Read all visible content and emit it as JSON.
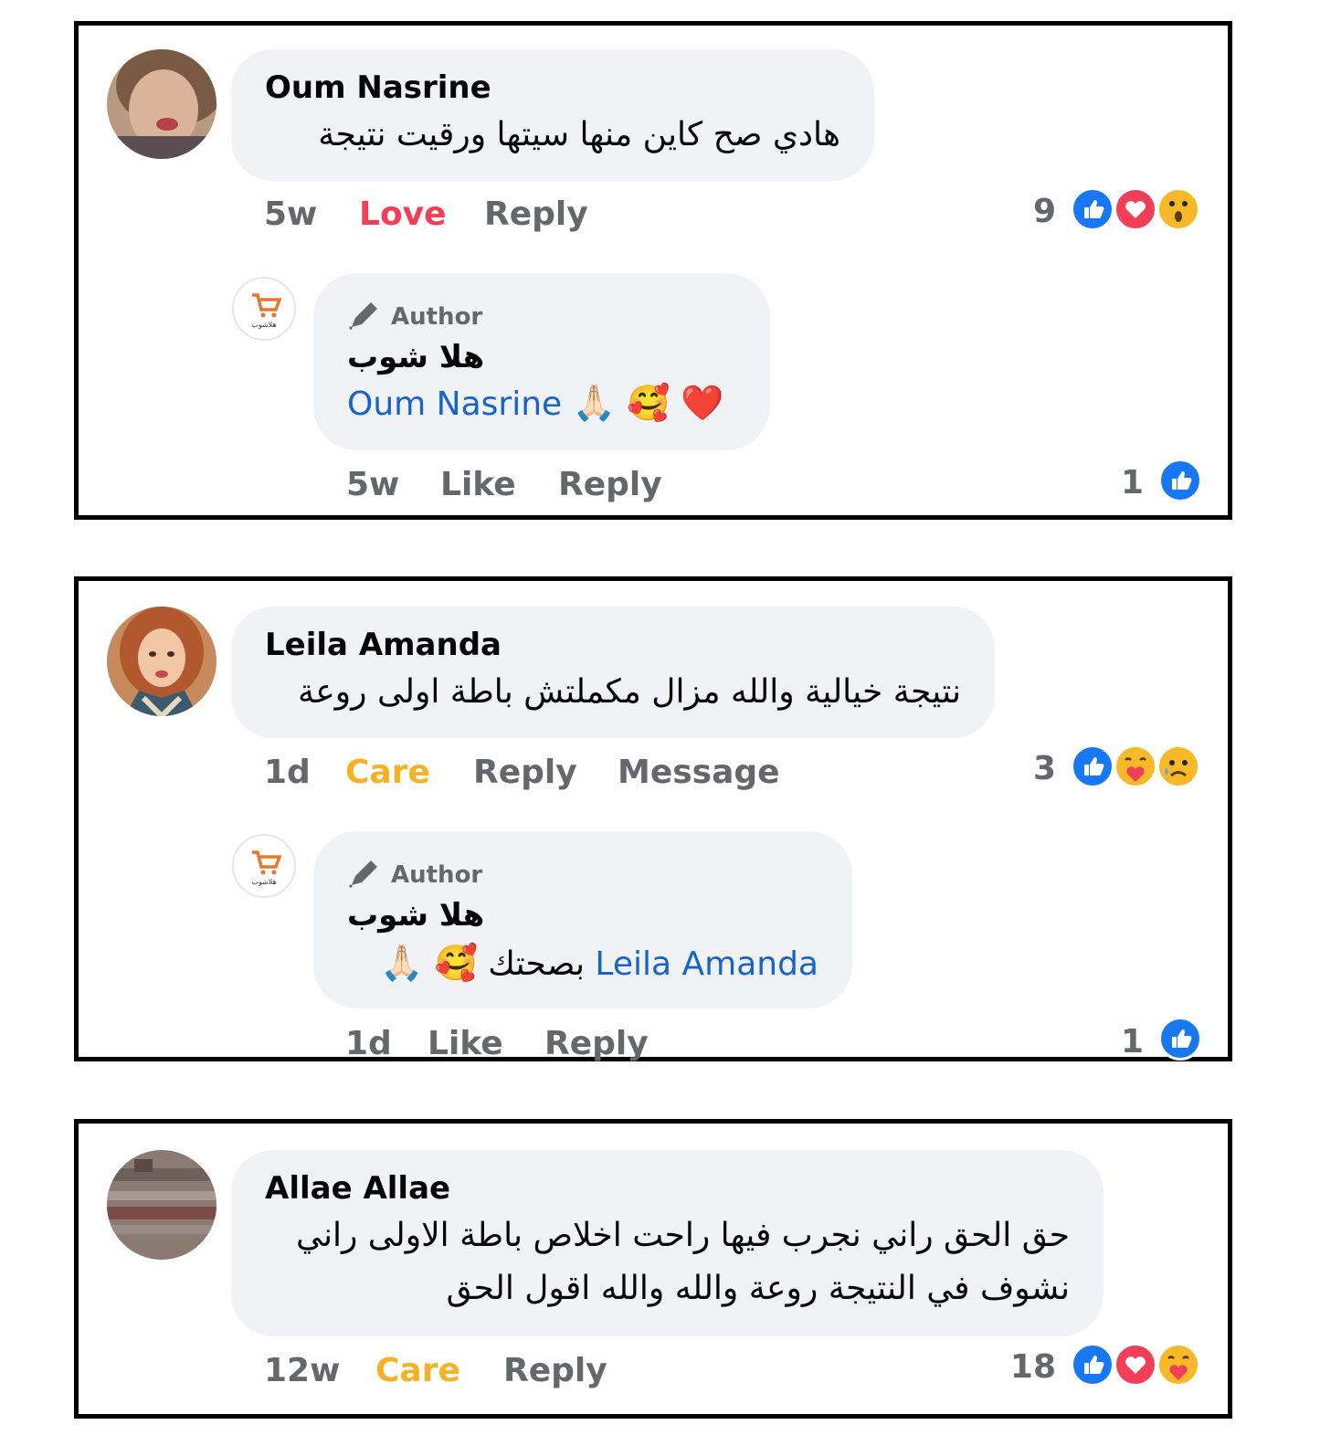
{
  "comments": [
    {
      "author": "Oum Nasrine",
      "text": "هادي صح كاين منها سيتها ورقيت نتيجة",
      "time": "5w",
      "reaction_label": "Love",
      "reply_label": "Reply",
      "reaction_count": "9",
      "reactions": [
        "like",
        "love",
        "wow"
      ],
      "reply": {
        "badge": "Author",
        "author": "هلا شوب",
        "mention": "Oum Nasrine",
        "trailing": "",
        "emojis": "🙏🏻 🥰 ❤️",
        "time": "5w",
        "like_label": "Like",
        "reply_label": "Reply",
        "reaction_count": "1"
      }
    },
    {
      "author": "Leila Amanda",
      "text": "نتيجة خيالية والله مزال مكملتش باطة اولى روعة",
      "time": "1d",
      "reaction_label": "Care",
      "reply_label": "Reply",
      "message_label": "Message",
      "reaction_count": "3",
      "reactions": [
        "like",
        "care",
        "sad"
      ],
      "reply": {
        "badge": "Author",
        "author": "هلا شوب",
        "mention": "Leila Amanda",
        "trailing": "بصحتك",
        "emojis": "🥰 🙏🏻",
        "time": "1d",
        "like_label": "Like",
        "reply_label": "Reply",
        "reaction_count": "1"
      }
    },
    {
      "author": "Allae Allae",
      "text_line1": "حق الحق راني نجرب فيها راحت اخلاص باطة الاولى راني",
      "text_line2": "نشوف في النتيجة روعة والله والله اقول الحق",
      "time": "12w",
      "reaction_label": "Care",
      "reply_label": "Reply",
      "reaction_count": "18",
      "reactions": [
        "like",
        "love",
        "care"
      ]
    }
  ],
  "page_avatar_text": "هلاشوب",
  "colors": {
    "like_blue": "#1877f2",
    "love_red": "#f33e58",
    "care_yellow": "#f7b125",
    "mention_blue": "#1664c9",
    "meta_grey": "#65676b",
    "bubble_bg": "#f0f2f5"
  }
}
